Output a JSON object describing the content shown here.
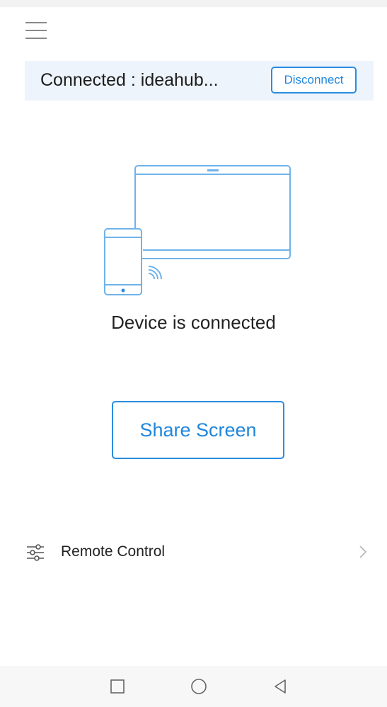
{
  "header": {
    "menu_icon": "hamburger-menu-icon"
  },
  "connection": {
    "status_text": "Connected : ideahub...",
    "disconnect_label": "Disconnect"
  },
  "main": {
    "illustration_icon": "phone-to-display-cast-icon",
    "status_text": "Device is connected",
    "share_screen_label": "Share Screen"
  },
  "remote": {
    "icon": "sliders-icon",
    "label": "Remote Control",
    "chevron": "chevron-right-icon"
  },
  "colors": {
    "accent": "#2a8de0",
    "illustration": "#6fb3ea",
    "connection_bar_bg": "#eef4fb"
  },
  "nav": {
    "recents_icon": "square-recents-icon",
    "home_icon": "circle-home-icon",
    "back_icon": "triangle-back-icon"
  }
}
